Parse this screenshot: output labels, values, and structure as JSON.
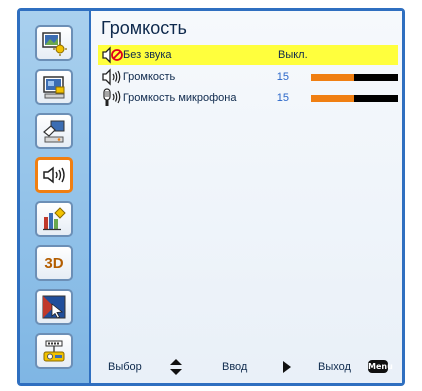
{
  "window": {
    "title": "Громкость"
  },
  "sidebar": {
    "items": [
      {
        "icon": "image-settings-icon",
        "active": false
      },
      {
        "icon": "display-settings-icon",
        "active": false
      },
      {
        "icon": "setup-icon",
        "active": false
      },
      {
        "icon": "volume-icon",
        "active": true
      },
      {
        "icon": "options-icon",
        "active": false
      },
      {
        "icon": "3d-icon",
        "label": "3D",
        "active": false
      },
      {
        "icon": "interactive-icon",
        "active": false
      },
      {
        "icon": "lan-icon",
        "active": false
      }
    ]
  },
  "menu": {
    "rows": [
      {
        "icon": "mute-icon",
        "label": "Без звука",
        "value": "Выкл.",
        "selected": true
      },
      {
        "icon": "speaker-icon",
        "label": "Громкость",
        "value": "15",
        "level": 0.5,
        "selected": false
      },
      {
        "icon": "microphone-icon",
        "label": "Громкость микрофона",
        "value": "15",
        "level": 0.5,
        "selected": false
      }
    ]
  },
  "footer": {
    "select_label": "Выбор",
    "enter_label": "Ввод",
    "exit_label": "Выход",
    "menu_key": "Menu"
  },
  "colors": {
    "frame": "#2f6fc0",
    "highlight": "#ffff3d",
    "accent": "#f07f12",
    "value_text": "#2a67c9"
  }
}
